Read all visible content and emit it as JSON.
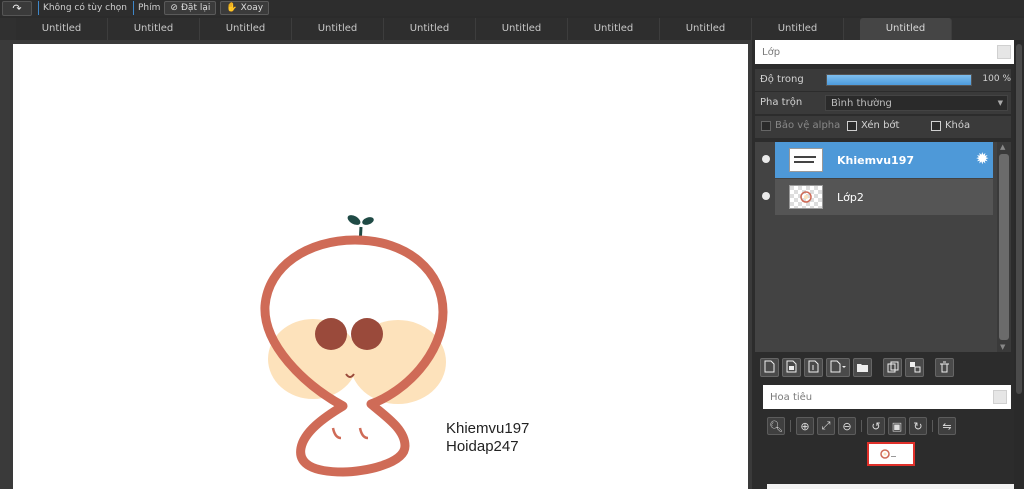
{
  "toolbar": {
    "redo_icon": "redo-arrow-icon",
    "option_text": "Không có tùy chọn",
    "key_label": "Phím",
    "reset_label": "Đặt lại",
    "rotate_label": "Xoay"
  },
  "tabs": [
    {
      "label": "Untitled"
    },
    {
      "label": "Untitled"
    },
    {
      "label": "Untitled"
    },
    {
      "label": "Untitled"
    },
    {
      "label": "Untitled"
    },
    {
      "label": "Untitled"
    },
    {
      "label": "Untitled"
    },
    {
      "label": "Untitled"
    },
    {
      "label": "Untitled"
    },
    {
      "label": "Untitled"
    }
  ],
  "canvas": {
    "signature_line1": "Khiemvu197",
    "signature_line2": "Hoidap247"
  },
  "layer_panel": {
    "title": "Lớp",
    "opacity_label": "Độ trong",
    "opacity_value": "100 %",
    "opacity_level": 1.0,
    "blend_label": "Pha trộn",
    "blend_value": "Bình thường",
    "protect_alpha": "Bảo vệ alpha",
    "clipping": "Xén bớt",
    "lock": "Khóa",
    "layers": [
      {
        "name": "Khiemvu197",
        "thumb_text": "Khiemvu197 Hoidap247",
        "selected": true
      },
      {
        "name": "Lớp2",
        "selected": false
      }
    ]
  },
  "navigator": {
    "title": "Hoa tiêu"
  },
  "colors": {
    "accent": "#4e99d8",
    "character_outline": "#cf6b57",
    "cheek": "#fde2bb",
    "eye": "#9a4a3b",
    "sprout": "#1f4a45"
  }
}
